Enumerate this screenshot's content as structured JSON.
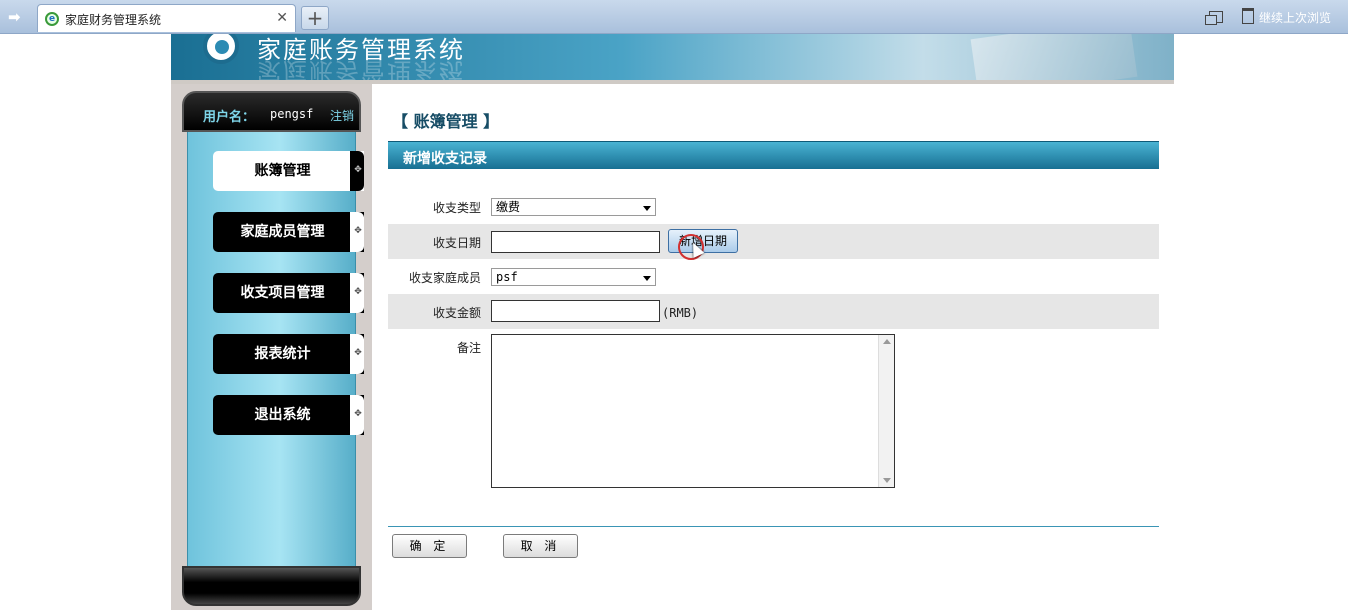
{
  "browser": {
    "tab_title": "家庭财务管理系统",
    "tab_close": "✕",
    "new_tab": "+",
    "nav_arrow": "➡",
    "restore_label": "继续上次浏览"
  },
  "app": {
    "title": "家庭账务管理系统"
  },
  "sidebar": {
    "user_label": "用户名：",
    "username": "pengsf",
    "logout": "注销",
    "items": [
      {
        "label": "账簿管理",
        "active": true
      },
      {
        "label": "家庭成员管理",
        "active": false
      },
      {
        "label": "收支项目管理",
        "active": false
      },
      {
        "label": "报表统计",
        "active": false
      },
      {
        "label": "退出系统",
        "active": false
      }
    ]
  },
  "main": {
    "breadcrumb": "【 账簿管理 】",
    "section_title": "新增收支记录",
    "form": {
      "type": {
        "label": "收支类型",
        "value": "缴费"
      },
      "date": {
        "label": "收支日期",
        "value": "",
        "button": "新增日期"
      },
      "member": {
        "label": "收支家庭成员",
        "value": "psf"
      },
      "amount": {
        "label": "收支金额",
        "value": "",
        "unit": "(RMB)"
      },
      "notes": {
        "label": "备注",
        "value": ""
      }
    },
    "confirm_button": "确 定",
    "cancel_button": "取 消"
  }
}
